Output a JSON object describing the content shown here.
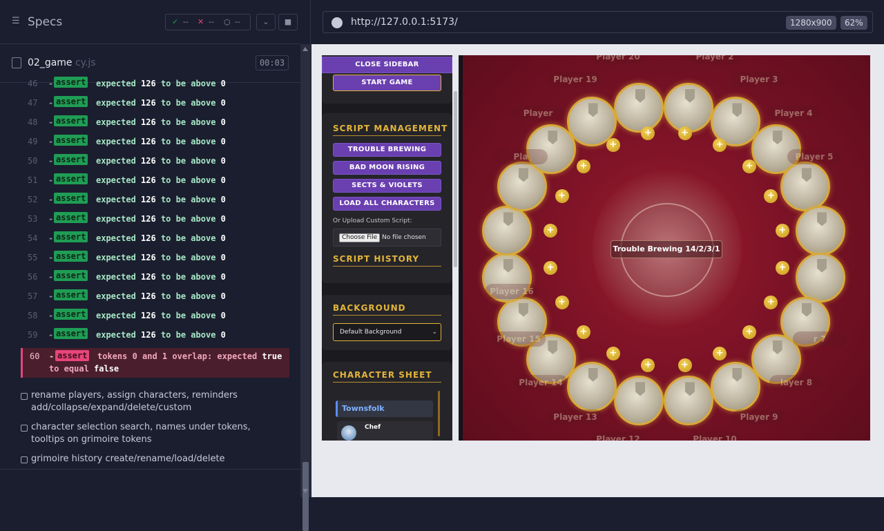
{
  "runner": {
    "header_title": "Specs",
    "stats": {
      "passed": "--",
      "failed": "--",
      "pending": "--"
    },
    "spec_file": {
      "name": "02_game",
      "ext": "cy.js",
      "timer": "00:03"
    },
    "log_rows": [
      {
        "num": "46",
        "tag": "assert",
        "pre": "expected",
        "a": "126",
        "mid": "to be above",
        "b": "0"
      },
      {
        "num": "47",
        "tag": "assert",
        "pre": "expected",
        "a": "126",
        "mid": "to be above",
        "b": "0"
      },
      {
        "num": "48",
        "tag": "assert",
        "pre": "expected",
        "a": "126",
        "mid": "to be above",
        "b": "0"
      },
      {
        "num": "49",
        "tag": "assert",
        "pre": "expected",
        "a": "126",
        "mid": "to be above",
        "b": "0"
      },
      {
        "num": "50",
        "tag": "assert",
        "pre": "expected",
        "a": "126",
        "mid": "to be above",
        "b": "0"
      },
      {
        "num": "51",
        "tag": "assert",
        "pre": "expected",
        "a": "126",
        "mid": "to be above",
        "b": "0"
      },
      {
        "num": "52",
        "tag": "assert",
        "pre": "expected",
        "a": "126",
        "mid": "to be above",
        "b": "0"
      },
      {
        "num": "53",
        "tag": "assert",
        "pre": "expected",
        "a": "126",
        "mid": "to be above",
        "b": "0"
      },
      {
        "num": "54",
        "tag": "assert",
        "pre": "expected",
        "a": "126",
        "mid": "to be above",
        "b": "0"
      },
      {
        "num": "55",
        "tag": "assert",
        "pre": "expected",
        "a": "126",
        "mid": "to be above",
        "b": "0"
      },
      {
        "num": "56",
        "tag": "assert",
        "pre": "expected",
        "a": "126",
        "mid": "to be above",
        "b": "0"
      },
      {
        "num": "57",
        "tag": "assert",
        "pre": "expected",
        "a": "126",
        "mid": "to be above",
        "b": "0"
      },
      {
        "num": "58",
        "tag": "assert",
        "pre": "expected",
        "a": "126",
        "mid": "to be above",
        "b": "0"
      },
      {
        "num": "59",
        "tag": "assert",
        "pre": "expected",
        "a": "126",
        "mid": "to be above",
        "b": "0"
      }
    ],
    "fail_row": {
      "num": "60",
      "tag": "assert",
      "msg": "tokens 0 and 1 overlap: expected",
      "a": "true",
      "mid": "to equal",
      "b": "false"
    },
    "tests": [
      "rename players, assign characters, reminders add/collapse/expand/delete/custom",
      "character selection search, names under tokens, tooltips on grimoire tokens",
      "grimoire history create/rename/load/delete"
    ]
  },
  "browser": {
    "url": "http://127.0.0.1:5173/",
    "viewport": "1280x900",
    "zoom": "62%"
  },
  "app": {
    "close_sidebar": "CLOSE SIDEBAR",
    "start_game": "START GAME",
    "script_management": "SCRIPT MANAGEMENT",
    "scripts": [
      "TROUBLE BREWING",
      "BAD MOON RISING",
      "SECTS & VIOLETS",
      "LOAD ALL CHARACTERS"
    ],
    "upload_label": "Or Upload Custom Script:",
    "choose_file": "Choose File",
    "no_file": "No file chosen",
    "script_history": "SCRIPT HISTORY",
    "background_title": "BACKGROUND",
    "background_value": "Default Background",
    "character_sheet": "CHARACTER SHEET",
    "townsfolk": "Townsfolk",
    "first_char": "Chef",
    "center_label": "Trouble Brewing 14/2/3/1",
    "player_labels": {
      "p20": "Player 20",
      "p2": "Player 2",
      "p19": "Player 19",
      "p3": "Player 3",
      "p18": "Player",
      "p4": "Player 4",
      "p17": "Pla",
      "p5": "Player 5",
      "p16": "Player 16",
      "p15": "Player 15",
      "p7": "r 7",
      "p14": "Player 14",
      "p8": "layer 8",
      "p13": "Player 13",
      "p9": "Player 9",
      "p12": "Player 12",
      "p10": "Player 10"
    },
    "reminder_symbol": "+"
  },
  "colors": {
    "pass": "#1f9d55",
    "fail": "#e7457a",
    "accent": "#6a3fb0",
    "gold": "#e2b53a"
  }
}
